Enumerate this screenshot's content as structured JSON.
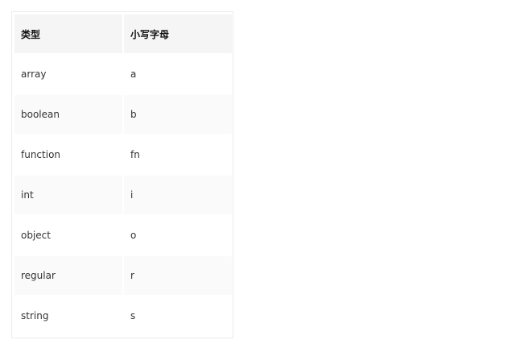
{
  "table": {
    "headers": [
      "类型",
      "小写字母"
    ],
    "rows": [
      [
        "array",
        "a"
      ],
      [
        "boolean",
        "b"
      ],
      [
        "function",
        "fn"
      ],
      [
        "int",
        "i"
      ],
      [
        "object",
        "o"
      ],
      [
        "regular",
        "r"
      ],
      [
        "string",
        "s"
      ]
    ]
  }
}
